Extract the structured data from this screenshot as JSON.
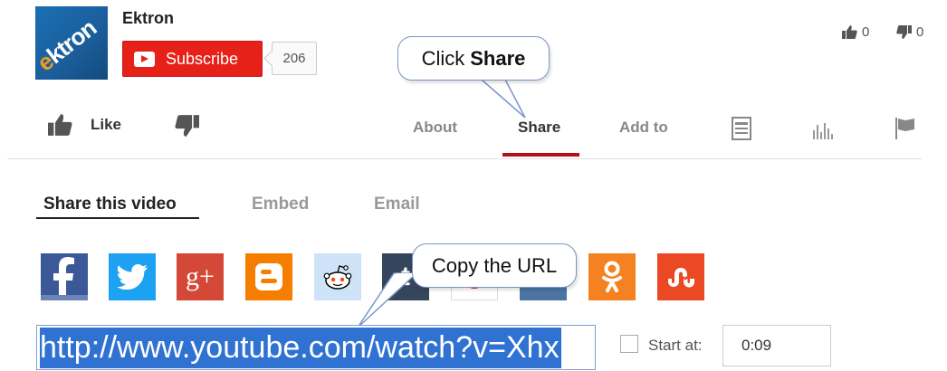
{
  "channel": {
    "logo_text_e": "e",
    "logo_text_rest": "ktron",
    "name": "Ektron",
    "subscribe_label": "Subscribe",
    "subscriber_count": "206"
  },
  "ratings": {
    "likes": "0",
    "dislikes": "0"
  },
  "callouts": {
    "share_prefix": "Click",
    "share_bold": "Share",
    "url": "Copy the URL"
  },
  "actions": {
    "like_label": "Like",
    "tabs": [
      {
        "label": "About"
      },
      {
        "label": "Share"
      },
      {
        "label": "Add to"
      }
    ],
    "icons": [
      "transcript-icon",
      "stats-icon",
      "flag-icon"
    ]
  },
  "share_panel": {
    "subtabs": [
      {
        "label": "Share this video"
      },
      {
        "label": "Embed"
      },
      {
        "label": "Email"
      }
    ],
    "social": [
      {
        "name": "facebook",
        "color": "#3b5998",
        "glyph": "f"
      },
      {
        "name": "twitter",
        "color": "#1da1f2",
        "glyph": "t"
      },
      {
        "name": "google-plus",
        "color": "#d34836",
        "glyph": "g+"
      },
      {
        "name": "blogger",
        "color": "#f57d00",
        "glyph": "B"
      },
      {
        "name": "reddit",
        "color": "#cee3f8",
        "glyph": "reddit"
      },
      {
        "name": "tumblr",
        "color": "#35465c",
        "glyph": "t"
      },
      {
        "name": "pinterest",
        "color": "#ffffff",
        "glyph": "p"
      },
      {
        "name": "vkontakte",
        "color": "#4c75a3",
        "glyph": "vk"
      },
      {
        "name": "odnoklassniki",
        "color": "#f58220",
        "glyph": "ok"
      },
      {
        "name": "stumbleupon",
        "color": "#eb4924",
        "glyph": "su"
      }
    ],
    "url_value": "http://www.youtube.com/watch?v=Xhx",
    "start_at_label": "Start at:",
    "start_at_value": "0:09"
  }
}
